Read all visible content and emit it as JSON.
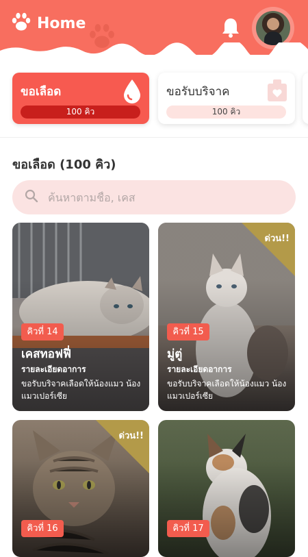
{
  "header": {
    "title": "Home",
    "brand_color": "#f86e5f"
  },
  "categories": [
    {
      "label": "ขอเลือด",
      "count": "100 คิว",
      "icon": "blood-drop-icon",
      "active": true
    },
    {
      "label": "ขอรับบริจาค",
      "count": "100 คิว",
      "icon": "donation-box-icon",
      "active": false
    }
  ],
  "section": {
    "title": "ขอเลือด (100 คิว)"
  },
  "search": {
    "placeholder": "ค้นหาตามชื่อ, เคส"
  },
  "cards": [
    {
      "queue": "คิวที่ 14",
      "name": "เคสทอฟฟี่",
      "detail_title": "รายละเอียดอาการ",
      "detail": "ขอรับบริจาคเลือดให้น้องแมว น้องแมวเปอร์เซีย",
      "urgent": ""
    },
    {
      "queue": "คิวที่ 15",
      "name": "มู่ตู่",
      "detail_title": "รายละเอียดอาการ",
      "detail": "ขอรับบริจาคเลือดให้น้องแมว น้องแมวเปอร์เซีย",
      "urgent": "ด่วน!!"
    },
    {
      "queue": "คิวที่ 16",
      "name": "",
      "detail_title": "",
      "detail": "",
      "urgent": "ด่วน!!"
    },
    {
      "queue": "คิวที่ 17",
      "name": "",
      "detail_title": "",
      "detail": "",
      "urgent": ""
    }
  ],
  "colors": {
    "accent": "#f75a50",
    "accent_dark": "#c81f1c",
    "queue_badge": "#f25c4e",
    "urgent_ribbon": "#b39a49",
    "search_bg": "#fbe3e2"
  }
}
